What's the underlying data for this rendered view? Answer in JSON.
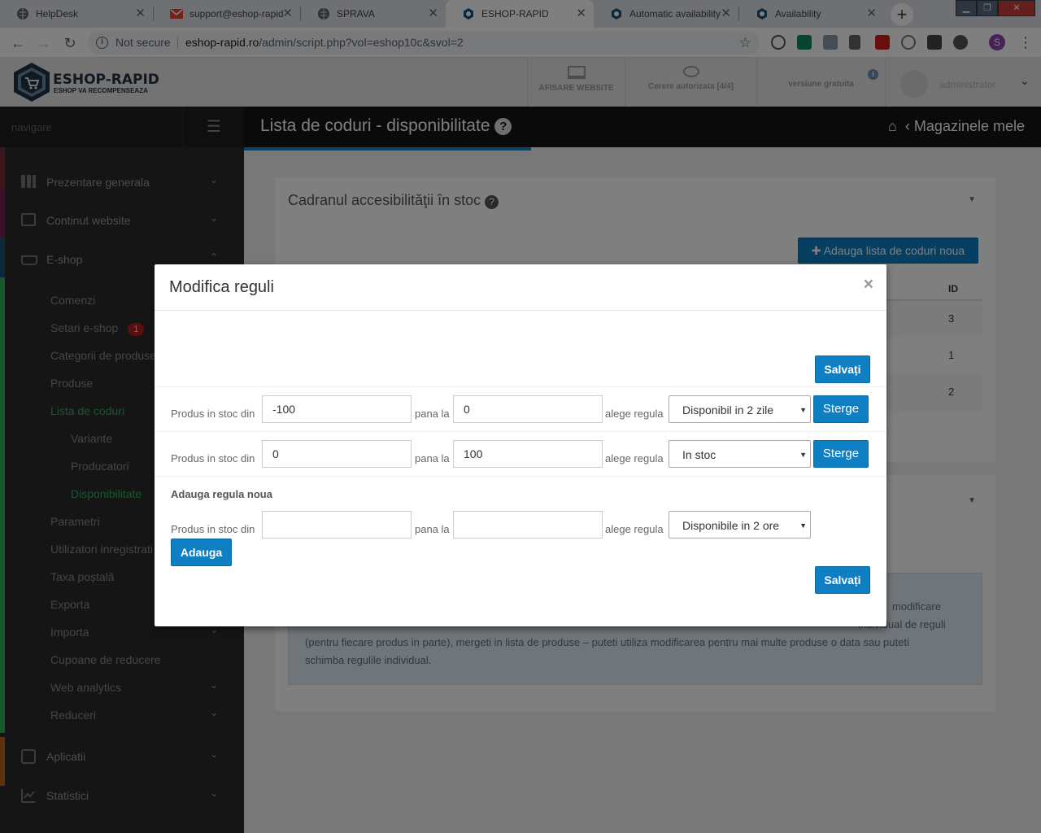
{
  "browser": {
    "tabs": [
      {
        "label": "HelpDesk",
        "icon": "globe-icon"
      },
      {
        "label": "support@eshop-rapid",
        "icon": "gmail-icon"
      },
      {
        "label": "SPRAVA",
        "icon": "globe-icon"
      },
      {
        "label": "ESHOP-RAPID",
        "icon": "eshop-icon",
        "active": true
      },
      {
        "label": "Automatic availability",
        "icon": "eshop-icon"
      },
      {
        "label": "Availability",
        "icon": "eshop-icon"
      }
    ],
    "security": "Not secure",
    "url_domain": "eshop-rapid.ro",
    "url_path": "/admin/script.php?vol=eshop10c&svol=2",
    "profile_letter": "S"
  },
  "header": {
    "logo_title": "ESHOP-RAPID",
    "logo_subtitle": "ESHOP VA RECOMPENSEAZA",
    "website_btn": "AFISARE WEBSITE",
    "requests_btn": "Cerere autorizata [4/4]",
    "version": "versiune gratuita",
    "user": "administrator"
  },
  "sidebar": {
    "nav_label": "navigare",
    "items": [
      {
        "label": "Prezentare generala"
      },
      {
        "label": "Continut website"
      },
      {
        "label": "E-shop"
      }
    ],
    "sub_items": [
      {
        "label": "Comenzi"
      },
      {
        "label": "Setari e-shop",
        "badge": "1"
      },
      {
        "label": "Categorii de produse"
      },
      {
        "label": "Produse"
      },
      {
        "label": "Lista de coduri"
      },
      {
        "label": "Variante"
      },
      {
        "label": "Producatori"
      },
      {
        "label": "Disponibilitate"
      },
      {
        "label": "Parametri"
      },
      {
        "label": "Utilizatori inregistrati"
      },
      {
        "label": "Taxa poștală"
      },
      {
        "label": "Exporta"
      },
      {
        "label": "Importa"
      },
      {
        "label": "Cupoane de reducere"
      },
      {
        "label": "Web analytics"
      },
      {
        "label": "Reduceri"
      }
    ],
    "bottom_items": [
      {
        "label": "Aplicatii"
      },
      {
        "label": "Statistici"
      }
    ]
  },
  "page": {
    "title": "Lista de coduri - disponibilitate",
    "breadcrumb": "Magazinele mele",
    "panel_title": "Cadranul accesibilităţii în stoc",
    "add_list_btn": "Adauga lista de coduri noua",
    "table_header_id": "ID",
    "table_ids": [
      "3",
      "1",
      "2"
    ],
    "info_text_1": "modificare",
    "info_text_2": "individual de reguli",
    "info_text_3": "(pentru fiecare produs in parte), mergeti in lista de produse – puteti utiliza modificarea pentru mai multe produse o data sau puteti",
    "info_text_4": "schimba regulile individual."
  },
  "modal": {
    "title": "Modifica reguli",
    "close": "×",
    "save_label": "Salvați",
    "label_from": "Produs in stoc din",
    "label_to": "pana la",
    "label_rule": "alege regula",
    "delete_label": "Sterge",
    "rules": [
      {
        "from": "-100",
        "to": "0",
        "rule": "Disponibil in 2 zile"
      },
      {
        "from": "0",
        "to": "100",
        "rule": "In stoc"
      }
    ],
    "new_rule_heading": "Adauga regula noua",
    "new_rule": {
      "from": "",
      "to": "",
      "rule": "Disponibile in 2 ore"
    },
    "add_label": "Adauga"
  },
  "colors": {
    "primary": "#0f7fc4",
    "sidebar_bg": "#2a2a2a",
    "titlebar_bg": "#141414",
    "active_green": "#2fae5b"
  }
}
